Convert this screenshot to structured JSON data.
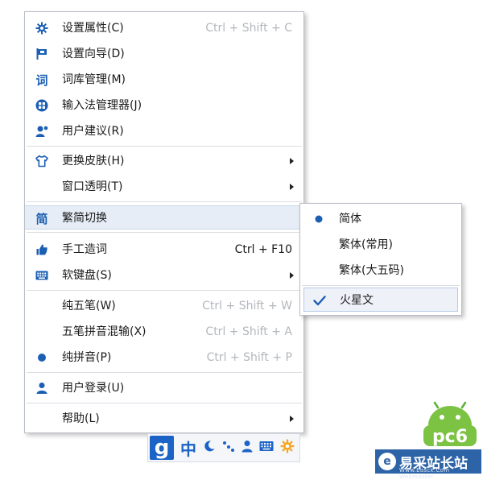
{
  "menu": {
    "items": [
      {
        "label": "设置属性(C)",
        "shortcut": "Ctrl + Shift + C",
        "icon": "gear-icon"
      },
      {
        "label": "设置向导(D)",
        "shortcut": "",
        "icon": "flag-icon"
      },
      {
        "label": "词库管理(M)",
        "shortcut": "",
        "icon": "dictionary-icon"
      },
      {
        "label": "输入法管理器(J)",
        "shortcut": "",
        "icon": "grid-circle-icon"
      },
      {
        "label": "用户建议(R)",
        "shortcut": "",
        "icon": "user-suggest-icon"
      },
      {
        "label": "更换皮肤(H)",
        "shortcut": "",
        "icon": "shirt-icon"
      },
      {
        "label": "窗口透明(T)",
        "shortcut": "",
        "icon": ""
      },
      {
        "label": "繁简切换",
        "shortcut": "",
        "icon": "jian-icon",
        "icon_text": "简"
      },
      {
        "label": "手工造词",
        "shortcut": "Ctrl + F10",
        "icon": "thumb-icon"
      },
      {
        "label": "软键盘(S)",
        "shortcut": "",
        "icon": "keyboard-icon"
      },
      {
        "label": "纯五笔(W)",
        "shortcut": "Ctrl + Shift + W",
        "icon": ""
      },
      {
        "label": "五笔拼音混输(X)",
        "shortcut": "Ctrl + Shift + A",
        "icon": ""
      },
      {
        "label": "纯拼音(P)",
        "shortcut": "Ctrl + Shift + P",
        "icon": "dot-icon"
      },
      {
        "label": "用户登录(U)",
        "shortcut": "",
        "icon": "user-icon"
      },
      {
        "label": "帮助(L)",
        "shortcut": "",
        "icon": ""
      }
    ]
  },
  "submenu": {
    "items": [
      {
        "label": "简体",
        "marker": "dot"
      },
      {
        "label": "繁体(常用)",
        "marker": ""
      },
      {
        "label": "繁体(大五码)",
        "marker": ""
      },
      {
        "label": "火星文",
        "marker": "check"
      }
    ]
  },
  "taskbar": {
    "logo": "g",
    "mode": "中"
  },
  "watermark": {
    "badge": "pc6",
    "name": "易采站长站",
    "sub": "Www.Easck.Com Webmaster"
  },
  "colors": {
    "accent": "#1b5fb3",
    "highlight": "#e6edf7",
    "shortcut_gray": "#b3b7bd",
    "taskbar_blue": "#1b63c6",
    "settings_orange": "#f5a524"
  }
}
